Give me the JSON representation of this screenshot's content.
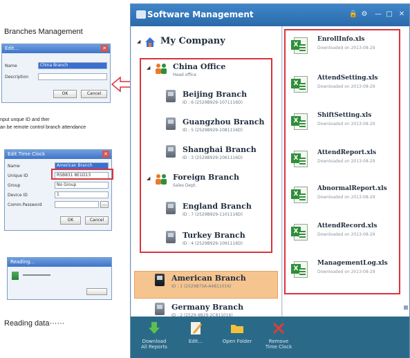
{
  "callouts": {
    "branches_heading": "Branches Management",
    "hint_line1": "nput unque ID and ther",
    "hint_line2": "an be remote control branch attendance",
    "reading": "Reading data······"
  },
  "edit_dialog": {
    "title": "Edit...",
    "name_label": "Name",
    "name_value": "China Branch",
    "desc_label": "Description",
    "ok": "OK",
    "cancel": "Cancel"
  },
  "clock_dialog": {
    "title": "Edit Time Clock",
    "name_label": "Name",
    "name_value": "American Branch",
    "uid_label": "Unique ID",
    "uid_value": "RSB831 8E1D13",
    "group_label": "Group",
    "group_value": "No Group",
    "device_label": "Device ID",
    "device_value": "1",
    "pwd_label": "Comm.Password",
    "ok": "OK",
    "cancel": "Cancel"
  },
  "reading_dialog": {
    "title": "Reading..."
  },
  "app": {
    "title": "Software Management",
    "company": "My Company",
    "groups": [
      {
        "name": "China Office",
        "sub": "Head office",
        "branches": [
          {
            "name": "Beijing Branch",
            "sub": "ID : 6  (2529B929-1071116D)"
          },
          {
            "name": "Guangzhou Branch",
            "sub": "ID : 5  (2529B929-1081116D)"
          },
          {
            "name": "Shanghai Branch",
            "sub": "ID : 3  (2529B929-1061116D)"
          }
        ]
      },
      {
        "name": "Foreign Branch",
        "sub": "Sales Dept.",
        "branches": [
          {
            "name": "England Branch",
            "sub": "ID : 7  (2529B929-1101116D)"
          },
          {
            "name": "Turkey Branch",
            "sub": "ID : 4  (2529B929-1091116D)"
          }
        ]
      }
    ],
    "american": {
      "name": "American Branch",
      "sub": "ID : 1  (2529B75A-A4811016)"
    },
    "germany": {
      "name": "Germany Branch",
      "sub": "ID : 2  (2529-9B29-2C811016)"
    },
    "files": [
      {
        "name": "EnrollInfo.xls",
        "sub": "Downloaded on 2013-08-29"
      },
      {
        "name": "AttendSetting.xls",
        "sub": "Downloaded on 2013-08-29"
      },
      {
        "name": "ShiftSetting.xls",
        "sub": "Downloaded on 2013-08-29"
      },
      {
        "name": "AttendReport.xls",
        "sub": "Downloaded on 2013-08-29"
      },
      {
        "name": "AbnormalReport.xls",
        "sub": "Downloaded on 2013-08-29"
      },
      {
        "name": "AttendRecord.xls",
        "sub": "Downloaded on 2013-08-29"
      },
      {
        "name": "ManagementLog.xls",
        "sub": "Downloaded on 2013-08-29"
      }
    ],
    "toolbar": {
      "download_l1": "Download",
      "download_l2": "All Reports",
      "edit": "Edit...",
      "open_folder": "Open Folder",
      "remove_l1": "Remove",
      "remove_l2": "Time Clock"
    }
  },
  "colors": {
    "titlebar": "#2a6aaa",
    "toolbar": "#2a6a88",
    "highlight": "#f6c48f",
    "callout_red": "#d9323b",
    "excel_green": "#2f8f3a"
  }
}
